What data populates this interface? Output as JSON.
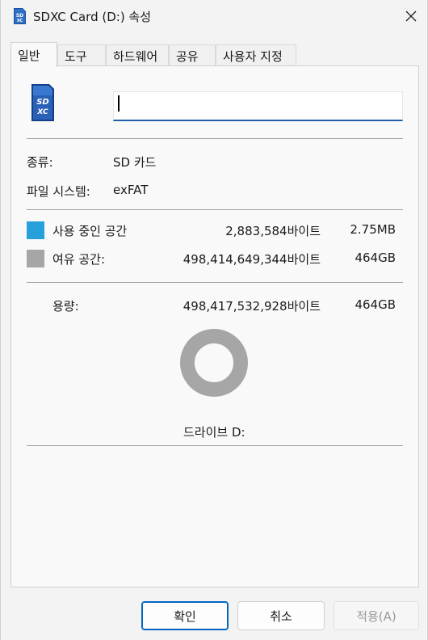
{
  "window": {
    "title": "SDXC Card (D:) 속성"
  },
  "tabs": [
    {
      "label": "일반"
    },
    {
      "label": "도구"
    },
    {
      "label": "하드웨어"
    },
    {
      "label": "공유"
    },
    {
      "label": "사용자 지정"
    }
  ],
  "general": {
    "name_value": "",
    "type_label": "종류:",
    "type_value": "SD 카드",
    "fs_label": "파일 시스템:",
    "fs_value": "exFAT",
    "used_label": "사용 중인 공간",
    "used_bytes": "2,883,584바이트",
    "used_short": "2.75MB",
    "free_label": "여유 공간:",
    "free_bytes": "498,414,649,344바이트",
    "free_short": "464GB",
    "capacity_label": "용량:",
    "capacity_bytes": "498,417,532,928바이트",
    "capacity_short": "464GB",
    "drive_label": "드라이브 D:",
    "used_fraction": 5.8e-06
  },
  "colors": {
    "used": "#26a0da",
    "free": "#a6a6a6",
    "accent": "#0067c0"
  },
  "icons": {
    "drive": "sdxc-card-icon",
    "close": "close-icon"
  },
  "buttons": {
    "ok": "확인",
    "cancel": "취소",
    "apply": "적용(A)"
  }
}
